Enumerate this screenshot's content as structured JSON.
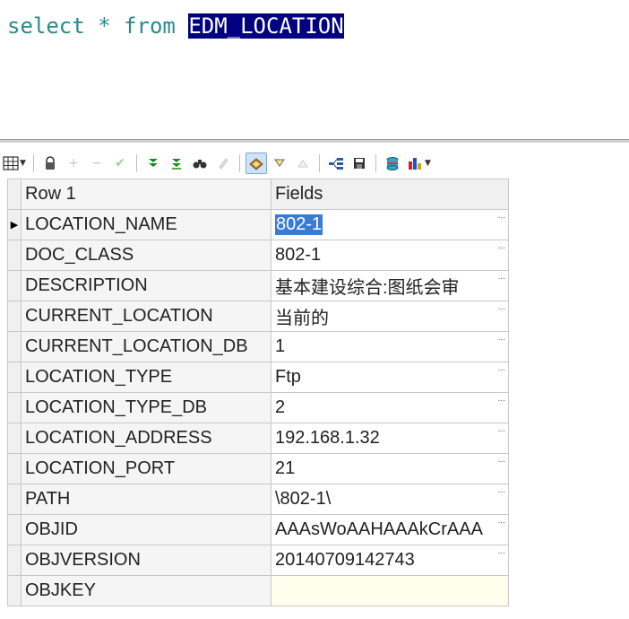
{
  "editor": {
    "sql_keyword1": "select",
    "sql_star": "*",
    "sql_keyword2": "from",
    "sql_table": "EDM_LOCATION"
  },
  "toolbar": {
    "icons": [
      "grid-view-icon",
      "lock-icon",
      "add-icon",
      "remove-icon",
      "post-icon",
      "first-record-icon",
      "last-record-icon",
      "find-icon",
      "clear-icon",
      "filter-icon",
      "sort-desc-icon",
      "sort-asc-icon",
      "query-plan-icon",
      "save-icon",
      "export-icon",
      "chart-icon"
    ]
  },
  "grid": {
    "header": {
      "row_label": "Row 1",
      "fields_label": "Fields"
    },
    "rows": [
      {
        "name": "LOCATION_NAME",
        "value": "802-1"
      },
      {
        "name": "DOC_CLASS",
        "value": "802-1"
      },
      {
        "name": "DESCRIPTION",
        "value": "基本建设综合:图纸会审"
      },
      {
        "name": "CURRENT_LOCATION",
        "value": "当前的"
      },
      {
        "name": "CURRENT_LOCATION_DB",
        "value": "1"
      },
      {
        "name": "LOCATION_TYPE",
        "value": "Ftp"
      },
      {
        "name": "LOCATION_TYPE_DB",
        "value": "2"
      },
      {
        "name": "LOCATION_ADDRESS",
        "value": "192.168.1.32"
      },
      {
        "name": "LOCATION_PORT",
        "value": "21"
      },
      {
        "name": "PATH",
        "value": "\\802-1\\"
      },
      {
        "name": "OBJID",
        "value": "AAAsWoAAHAAAkCrAAA"
      },
      {
        "name": "OBJVERSION",
        "value": "20140709142743"
      },
      {
        "name": "OBJKEY",
        "value": ""
      }
    ],
    "ellipsis": "..."
  },
  "colors": {
    "selection": "#000080",
    "keyword": "#2a8a8a",
    "cell_selection": "#3a7bd5",
    "empty_cell": "#ffffee"
  }
}
